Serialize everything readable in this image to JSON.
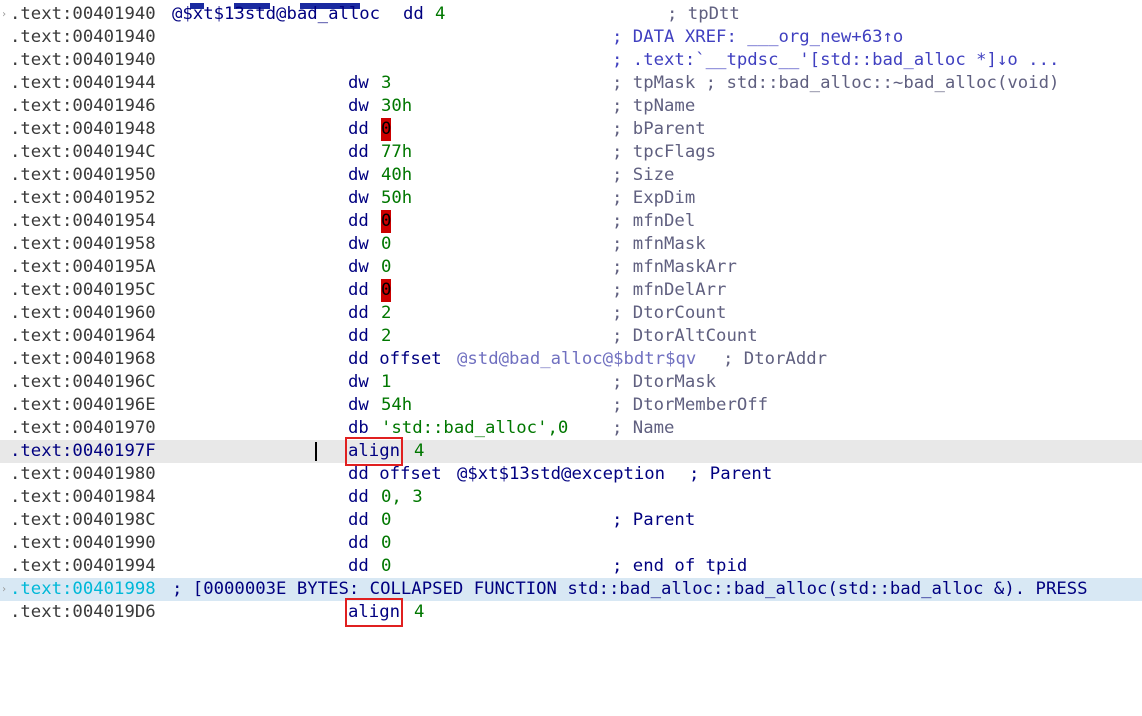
{
  "colors": {
    "highlight_line": "#e8e8e8",
    "collapsed_line": "#d8e8f4",
    "red_marker": "#cc0000",
    "box": "#e02020"
  },
  "lines": [
    {
      "addr": ".text:00401940",
      "label": "@$xt$13std@bad_alloc",
      "op": "dd",
      "operand": "4",
      "comment": "; tpDtt"
    },
    {
      "addr": ".text:00401940",
      "comment": "; DATA XREF: ___org_new+63↑o"
    },
    {
      "addr": ".text:00401940",
      "comment": "; .text:`__tpdsc__'[std::bad_alloc *]↓o ..."
    },
    {
      "addr": ".text:00401944",
      "op": "dw",
      "operand": "3",
      "comment": "; tpMask ; std::bad_alloc::~bad_alloc(void)"
    },
    {
      "addr": ".text:00401946",
      "op": "dw",
      "operand": "30h",
      "comment": "; tpName"
    },
    {
      "addr": ".text:00401948",
      "op": "dd",
      "operand": "0",
      "comment": "; bParent"
    },
    {
      "addr": ".text:0040194C",
      "op": "dd",
      "operand": "77h",
      "comment": "; tpcFlags"
    },
    {
      "addr": ".text:00401950",
      "op": "dw",
      "operand": "40h",
      "comment": "; Size"
    },
    {
      "addr": ".text:00401952",
      "op": "dw",
      "operand": "50h",
      "comment": "; ExpDim"
    },
    {
      "addr": ".text:00401954",
      "op": "dd",
      "operand": "0",
      "comment": "; mfnDel"
    },
    {
      "addr": ".text:00401958",
      "op": "dw",
      "operand": "0",
      "comment": "; mfnMask"
    },
    {
      "addr": ".text:0040195A",
      "op": "dw",
      "operand": "0",
      "comment": "; mfnMaskArr"
    },
    {
      "addr": ".text:0040195C",
      "op": "dd",
      "operand": "0",
      "comment": "; mfnDelArr"
    },
    {
      "addr": ".text:00401960",
      "op": "dd",
      "operand": "2",
      "comment": "; DtorCount"
    },
    {
      "addr": ".text:00401964",
      "op": "dd",
      "operand": "2",
      "comment": "; DtorAltCount"
    },
    {
      "addr": ".text:00401968",
      "op": "dd offset",
      "operand": "@std@bad_alloc@$bdtr$qv",
      "comment": "; DtorAddr"
    },
    {
      "addr": ".text:0040196C",
      "op": "dw",
      "operand": "1",
      "comment": "; DtorMask"
    },
    {
      "addr": ".text:0040196E",
      "op": "dw",
      "operand": "54h",
      "comment": "; DtorMemberOff"
    },
    {
      "addr": ".text:00401970",
      "op": "db",
      "operand": "'std::bad_alloc',0",
      "comment": "; Name"
    },
    {
      "addr": ".text:0040197F",
      "op": "align",
      "operand": "4"
    },
    {
      "addr": ".text:00401980",
      "op": "dd offset",
      "operand": "@$xt$13std@exception",
      "comment": "; Parent"
    },
    {
      "addr": ".text:00401984",
      "op": "dd",
      "operand": "0, 3"
    },
    {
      "addr": ".text:0040198C",
      "op": "dd",
      "operand": "0",
      "comment": "; Parent"
    },
    {
      "addr": ".text:00401990",
      "op": "dd",
      "operand": "0"
    },
    {
      "addr": ".text:00401994",
      "op": "dd",
      "operand": "0",
      "comment": "; end of tpid"
    },
    {
      "addr": ".text:00401998",
      "comment": "; [0000003E BYTES: COLLAPSED FUNCTION std::bad_alloc::bad_alloc(std::bad_alloc &). PRESS"
    },
    {
      "addr": ".text:004019D6",
      "op": "align",
      "operand": "4"
    }
  ]
}
